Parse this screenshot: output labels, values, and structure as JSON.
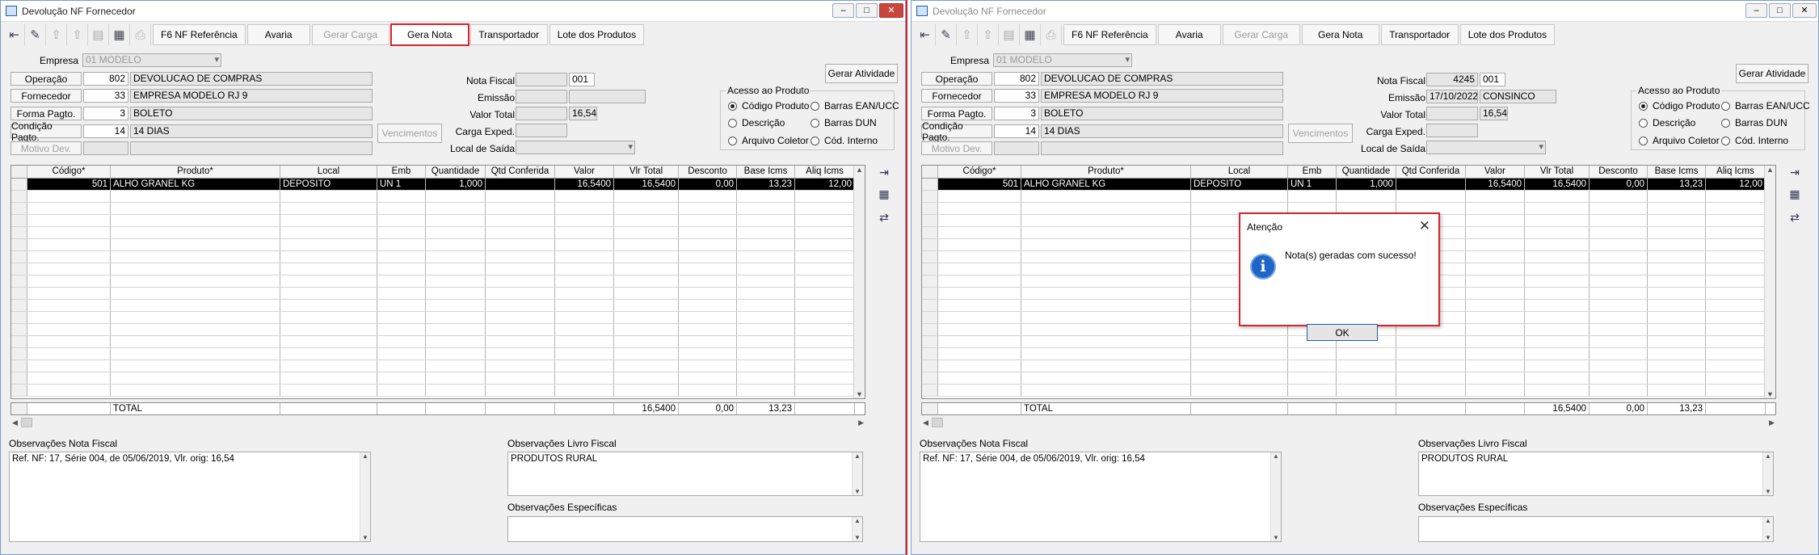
{
  "windows": [
    {
      "title": "Devolução NF Fornecedor",
      "toolbar": {
        "f6": "F6 NF Referência",
        "avaria": "Avaria",
        "gerar_carga": "Gerar Carga",
        "gera_nota": "Gera Nota",
        "transportador": "Transportador",
        "lote": "Lote dos Produtos"
      },
      "form": {
        "empresa_label": "Empresa",
        "empresa": "01 MODELO",
        "operacao_label": "Operação",
        "operacao_cod": "802",
        "operacao_desc": "DEVOLUCAO DE COMPRAS",
        "fornecedor_label": "Fornecedor",
        "fornecedor_cod": "33",
        "fornecedor_desc": "EMPRESA MODELO RJ 9",
        "forma_label": "Forma Pagto.",
        "forma_cod": "3",
        "forma_desc": "BOLETO",
        "condicao_label": "Condição Pagto.",
        "condicao_cod": "14",
        "condicao_desc": "14 DIAS",
        "motivo_label": "Motivo Dev.",
        "vencimentos": "Vencimentos",
        "nota_label": "Nota Fiscal",
        "nota_num": "",
        "nota_serie": "001",
        "emissao_label": "Emissão",
        "emissao_data": "",
        "emissao_user": "",
        "valor_label": "Valor Total",
        "valor": "16,54",
        "carga_label": "Carga Exped.",
        "local_label": "Local de Saída",
        "gerar_atividade": "Gerar Atividade",
        "acesso_title": "Acesso ao Produto",
        "radio_codigo": "Código Produto",
        "radio_ean": "Barras EAN/UCC",
        "radio_descricao": "Descrição",
        "radio_dun": "Barras DUN",
        "radio_coletor": "Arquivo Coletor",
        "radio_interno": "Cód. Interno"
      },
      "grid": {
        "columns": [
          "Código*",
          "Produto*",
          "Local",
          "Emb",
          "Quantidade",
          "Qtd Conferida",
          "Valor",
          "Vlr Total",
          "Desconto",
          "Base Icms",
          "Aliq Icms"
        ],
        "row": [
          "501",
          "ALHO GRANEL KG",
          "DEPOSITO",
          "UN 1",
          "1,000",
          "",
          "16,5400",
          "16,5400",
          "0,00",
          "13,23",
          "12,00"
        ],
        "total": [
          "TOTAL",
          "16,5400",
          "0,00",
          "13,23"
        ]
      },
      "obs": {
        "nf_label": "Observações Nota Fiscal",
        "nf_text": "Ref. NF: 17, Série 004, de 05/06/2019, Vlr. orig: 16,54",
        "livro_label": "Observações Livro Fiscal",
        "livro_text": "PRODUTOS RURAL",
        "espec_label": "Observações Específicas",
        "espec_text": ""
      }
    },
    {
      "title": "Devolução NF Fornecedor",
      "toolbar": {
        "f6": "F6 NF Referência",
        "avaria": "Avaria",
        "gerar_carga": "Gerar Carga",
        "gera_nota": "Gera Nota",
        "transportador": "Transportador",
        "lote": "Lote dos Produtos"
      },
      "form": {
        "empresa_label": "Empresa",
        "empresa": "01 MODELO",
        "operacao_label": "Operação",
        "operacao_cod": "802",
        "operacao_desc": "DEVOLUCAO DE COMPRAS",
        "fornecedor_label": "Fornecedor",
        "fornecedor_cod": "33",
        "fornecedor_desc": "EMPRESA MODELO RJ 9",
        "forma_label": "Forma Pagto.",
        "forma_cod": "3",
        "forma_desc": "BOLETO",
        "condicao_label": "Condição Pagto.",
        "condicao_cod": "14",
        "condicao_desc": "14 DIAS",
        "motivo_label": "Motivo Dev.",
        "vencimentos": "Vencimentos",
        "nota_label": "Nota Fiscal",
        "nota_num": "4245",
        "nota_serie": "001",
        "emissao_label": "Emissão",
        "emissao_data": "17/10/2022",
        "emissao_user": "CONSINCO",
        "valor_label": "Valor Total",
        "valor": "16,54",
        "carga_label": "Carga Exped.",
        "local_label": "Local de Saída",
        "gerar_atividade": "Gerar Atividade",
        "acesso_title": "Acesso ao Produto",
        "radio_codigo": "Código Produto",
        "radio_ean": "Barras EAN/UCC",
        "radio_descricao": "Descrição",
        "radio_dun": "Barras DUN",
        "radio_coletor": "Arquivo Coletor",
        "radio_interno": "Cód. Interno"
      },
      "grid": {
        "columns": [
          "Código*",
          "Produto*",
          "Local",
          "Emb",
          "Quantidade",
          "Qtd Conferida",
          "Valor",
          "Vlr Total",
          "Desconto",
          "Base Icms",
          "Aliq Icms"
        ],
        "row": [
          "501",
          "ALHO GRANEL KG",
          "DEPOSITO",
          "UN 1",
          "1,000",
          "",
          "16,5400",
          "16,5400",
          "0,00",
          "13,23",
          "12,00"
        ],
        "total": [
          "TOTAL",
          "16,5400",
          "0,00",
          "13,23"
        ]
      },
      "obs": {
        "nf_label": "Observações Nota Fiscal",
        "nf_text": "Ref. NF: 17, Série 004, de 05/06/2019, Vlr. orig: 16,54",
        "livro_label": "Observações Livro Fiscal",
        "livro_text": "PRODUTOS RURAL",
        "espec_label": "Observações Específicas",
        "espec_text": ""
      }
    }
  ],
  "dialog": {
    "title": "Atenção",
    "message": "Nota(s) geradas com sucesso!",
    "ok": "OK",
    "icon": "info-icon"
  },
  "colors": {
    "highlight": "#d9232d",
    "selected_row": "#000000"
  }
}
